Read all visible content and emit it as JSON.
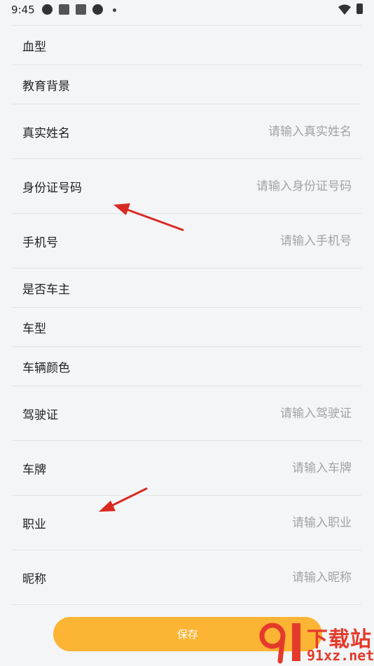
{
  "status_bar": {
    "time": "9:45",
    "icons": [
      "app-icon",
      "square-icon",
      "square-icon",
      "app-icon",
      "dot-icon"
    ],
    "right_icons": [
      "wifi-icon",
      "battery-icon"
    ]
  },
  "form": {
    "rows": [
      {
        "label": "血型",
        "placeholder": ""
      },
      {
        "label": "教育背景",
        "placeholder": ""
      },
      {
        "label": "真实姓名",
        "placeholder": "请输入真实姓名"
      },
      {
        "label": "身份证号码",
        "placeholder": "请输入身份证号码"
      },
      {
        "label": "手机号",
        "placeholder": "请输入手机号"
      },
      {
        "label": "是否车主",
        "placeholder": ""
      },
      {
        "label": "车型",
        "placeholder": ""
      },
      {
        "label": "车辆颜色",
        "placeholder": ""
      },
      {
        "label": "驾驶证",
        "placeholder": "请输入驾驶证"
      },
      {
        "label": "车牌",
        "placeholder": "请输入车牌"
      },
      {
        "label": "职业",
        "placeholder": "请输入职业"
      },
      {
        "label": "昵称",
        "placeholder": "请输入昵称"
      }
    ]
  },
  "save_button": {
    "label": "保存",
    "color": "#fbb433"
  },
  "annotations": {
    "arrow_color": "#d92a22"
  },
  "watermark": {
    "logo_text": "91",
    "title": "下载站",
    "url": "91xz.net",
    "color": "#e43a2c"
  }
}
